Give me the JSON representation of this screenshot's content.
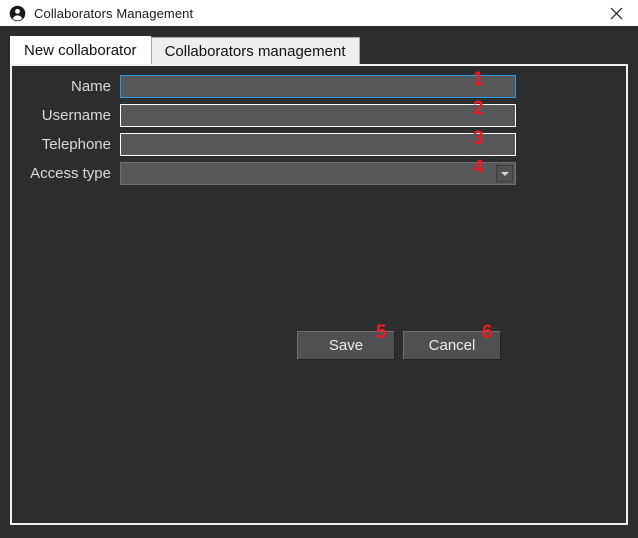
{
  "window": {
    "title": "Collaborators Management",
    "icon": "user-account-icon",
    "close_label": "✕",
    "background_color": "#2b2d2f",
    "titlebar_background": "#ffffff"
  },
  "tabs": [
    {
      "label": "New collaborator",
      "active": true
    },
    {
      "label": "Collaborators management",
      "active": false
    }
  ],
  "form": {
    "fields": [
      {
        "label": "Name",
        "value": "",
        "placeholder": "",
        "type": "text",
        "focused": true,
        "focus_color": "#2b9ae6"
      },
      {
        "label": "Username",
        "value": "",
        "placeholder": "",
        "type": "text",
        "focused": false
      },
      {
        "label": "Telephone",
        "value": "",
        "placeholder": "",
        "type": "text",
        "focused": false
      },
      {
        "label": "Access type",
        "value": "",
        "placeholder": "",
        "type": "select",
        "focused": false
      }
    ]
  },
  "actions": {
    "save_label": "Save",
    "cancel_label": "Cancel"
  },
  "annotations": {
    "color": "#ec1c22",
    "markers": [
      "1",
      "2",
      "3",
      "4",
      "5",
      "6"
    ]
  }
}
